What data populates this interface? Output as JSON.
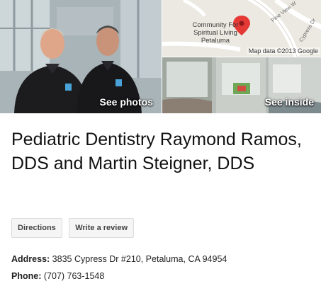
{
  "photos": {
    "see_photos_label": "See photos",
    "see_inside_label": "See inside"
  },
  "map": {
    "place_label": "Community For Spiritual Living Petaluma",
    "attribution": "Map data ©2013 Google",
    "streets": [
      "Pine View W",
      "Cypress Dr"
    ],
    "pin_color": "#e53935"
  },
  "business": {
    "name": "Pediatric Dentistry Raymond Ramos, DDS and Martin Steigner, DDS",
    "actions": {
      "directions_label": "Directions",
      "review_label": "Write a review"
    },
    "address_label": "Address:",
    "address_value": "3835 Cypress Dr #210, Petaluma, CA 94954",
    "phone_label": "Phone:",
    "phone_value": "(707) 763-1548"
  }
}
